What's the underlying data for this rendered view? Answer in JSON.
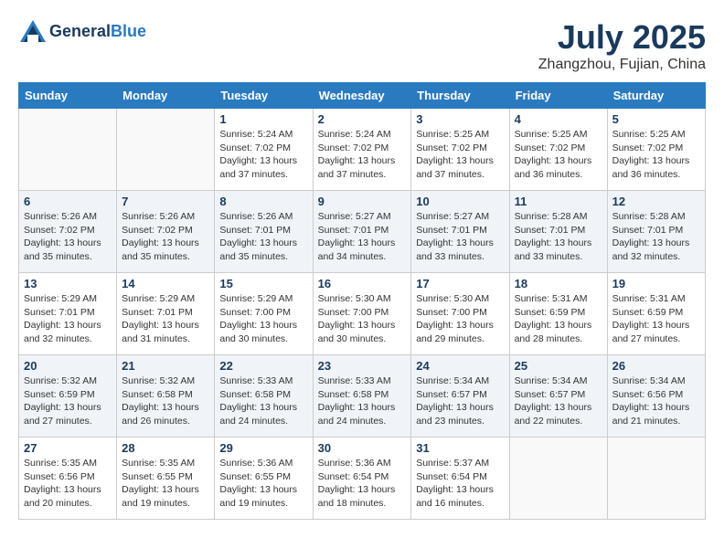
{
  "header": {
    "logo_general": "General",
    "logo_blue": "Blue",
    "month_year": "July 2025",
    "location": "Zhangzhou, Fujian, China"
  },
  "days_of_week": [
    "Sunday",
    "Monday",
    "Tuesday",
    "Wednesday",
    "Thursday",
    "Friday",
    "Saturday"
  ],
  "weeks": [
    [
      {
        "day": "",
        "sunrise": "",
        "sunset": "",
        "daylight": ""
      },
      {
        "day": "",
        "sunrise": "",
        "sunset": "",
        "daylight": ""
      },
      {
        "day": "1",
        "sunrise": "Sunrise: 5:24 AM",
        "sunset": "Sunset: 7:02 PM",
        "daylight": "Daylight: 13 hours and 37 minutes."
      },
      {
        "day": "2",
        "sunrise": "Sunrise: 5:24 AM",
        "sunset": "Sunset: 7:02 PM",
        "daylight": "Daylight: 13 hours and 37 minutes."
      },
      {
        "day": "3",
        "sunrise": "Sunrise: 5:25 AM",
        "sunset": "Sunset: 7:02 PM",
        "daylight": "Daylight: 13 hours and 37 minutes."
      },
      {
        "day": "4",
        "sunrise": "Sunrise: 5:25 AM",
        "sunset": "Sunset: 7:02 PM",
        "daylight": "Daylight: 13 hours and 36 minutes."
      },
      {
        "day": "5",
        "sunrise": "Sunrise: 5:25 AM",
        "sunset": "Sunset: 7:02 PM",
        "daylight": "Daylight: 13 hours and 36 minutes."
      }
    ],
    [
      {
        "day": "6",
        "sunrise": "Sunrise: 5:26 AM",
        "sunset": "Sunset: 7:02 PM",
        "daylight": "Daylight: 13 hours and 35 minutes."
      },
      {
        "day": "7",
        "sunrise": "Sunrise: 5:26 AM",
        "sunset": "Sunset: 7:02 PM",
        "daylight": "Daylight: 13 hours and 35 minutes."
      },
      {
        "day": "8",
        "sunrise": "Sunrise: 5:26 AM",
        "sunset": "Sunset: 7:01 PM",
        "daylight": "Daylight: 13 hours and 35 minutes."
      },
      {
        "day": "9",
        "sunrise": "Sunrise: 5:27 AM",
        "sunset": "Sunset: 7:01 PM",
        "daylight": "Daylight: 13 hours and 34 minutes."
      },
      {
        "day": "10",
        "sunrise": "Sunrise: 5:27 AM",
        "sunset": "Sunset: 7:01 PM",
        "daylight": "Daylight: 13 hours and 33 minutes."
      },
      {
        "day": "11",
        "sunrise": "Sunrise: 5:28 AM",
        "sunset": "Sunset: 7:01 PM",
        "daylight": "Daylight: 13 hours and 33 minutes."
      },
      {
        "day": "12",
        "sunrise": "Sunrise: 5:28 AM",
        "sunset": "Sunset: 7:01 PM",
        "daylight": "Daylight: 13 hours and 32 minutes."
      }
    ],
    [
      {
        "day": "13",
        "sunrise": "Sunrise: 5:29 AM",
        "sunset": "Sunset: 7:01 PM",
        "daylight": "Daylight: 13 hours and 32 minutes."
      },
      {
        "day": "14",
        "sunrise": "Sunrise: 5:29 AM",
        "sunset": "Sunset: 7:01 PM",
        "daylight": "Daylight: 13 hours and 31 minutes."
      },
      {
        "day": "15",
        "sunrise": "Sunrise: 5:29 AM",
        "sunset": "Sunset: 7:00 PM",
        "daylight": "Daylight: 13 hours and 30 minutes."
      },
      {
        "day": "16",
        "sunrise": "Sunrise: 5:30 AM",
        "sunset": "Sunset: 7:00 PM",
        "daylight": "Daylight: 13 hours and 30 minutes."
      },
      {
        "day": "17",
        "sunrise": "Sunrise: 5:30 AM",
        "sunset": "Sunset: 7:00 PM",
        "daylight": "Daylight: 13 hours and 29 minutes."
      },
      {
        "day": "18",
        "sunrise": "Sunrise: 5:31 AM",
        "sunset": "Sunset: 6:59 PM",
        "daylight": "Daylight: 13 hours and 28 minutes."
      },
      {
        "day": "19",
        "sunrise": "Sunrise: 5:31 AM",
        "sunset": "Sunset: 6:59 PM",
        "daylight": "Daylight: 13 hours and 27 minutes."
      }
    ],
    [
      {
        "day": "20",
        "sunrise": "Sunrise: 5:32 AM",
        "sunset": "Sunset: 6:59 PM",
        "daylight": "Daylight: 13 hours and 27 minutes."
      },
      {
        "day": "21",
        "sunrise": "Sunrise: 5:32 AM",
        "sunset": "Sunset: 6:58 PM",
        "daylight": "Daylight: 13 hours and 26 minutes."
      },
      {
        "day": "22",
        "sunrise": "Sunrise: 5:33 AM",
        "sunset": "Sunset: 6:58 PM",
        "daylight": "Daylight: 13 hours and 24 minutes."
      },
      {
        "day": "23",
        "sunrise": "Sunrise: 5:33 AM",
        "sunset": "Sunset: 6:58 PM",
        "daylight": "Daylight: 13 hours and 24 minutes."
      },
      {
        "day": "24",
        "sunrise": "Sunrise: 5:34 AM",
        "sunset": "Sunset: 6:57 PM",
        "daylight": "Daylight: 13 hours and 23 minutes."
      },
      {
        "day": "25",
        "sunrise": "Sunrise: 5:34 AM",
        "sunset": "Sunset: 6:57 PM",
        "daylight": "Daylight: 13 hours and 22 minutes."
      },
      {
        "day": "26",
        "sunrise": "Sunrise: 5:34 AM",
        "sunset": "Sunset: 6:56 PM",
        "daylight": "Daylight: 13 hours and 21 minutes."
      }
    ],
    [
      {
        "day": "27",
        "sunrise": "Sunrise: 5:35 AM",
        "sunset": "Sunset: 6:56 PM",
        "daylight": "Daylight: 13 hours and 20 minutes."
      },
      {
        "day": "28",
        "sunrise": "Sunrise: 5:35 AM",
        "sunset": "Sunset: 6:55 PM",
        "daylight": "Daylight: 13 hours and 19 minutes."
      },
      {
        "day": "29",
        "sunrise": "Sunrise: 5:36 AM",
        "sunset": "Sunset: 6:55 PM",
        "daylight": "Daylight: 13 hours and 19 minutes."
      },
      {
        "day": "30",
        "sunrise": "Sunrise: 5:36 AM",
        "sunset": "Sunset: 6:54 PM",
        "daylight": "Daylight: 13 hours and 18 minutes."
      },
      {
        "day": "31",
        "sunrise": "Sunrise: 5:37 AM",
        "sunset": "Sunset: 6:54 PM",
        "daylight": "Daylight: 13 hours and 16 minutes."
      },
      {
        "day": "",
        "sunrise": "",
        "sunset": "",
        "daylight": ""
      },
      {
        "day": "",
        "sunrise": "",
        "sunset": "",
        "daylight": ""
      }
    ]
  ]
}
